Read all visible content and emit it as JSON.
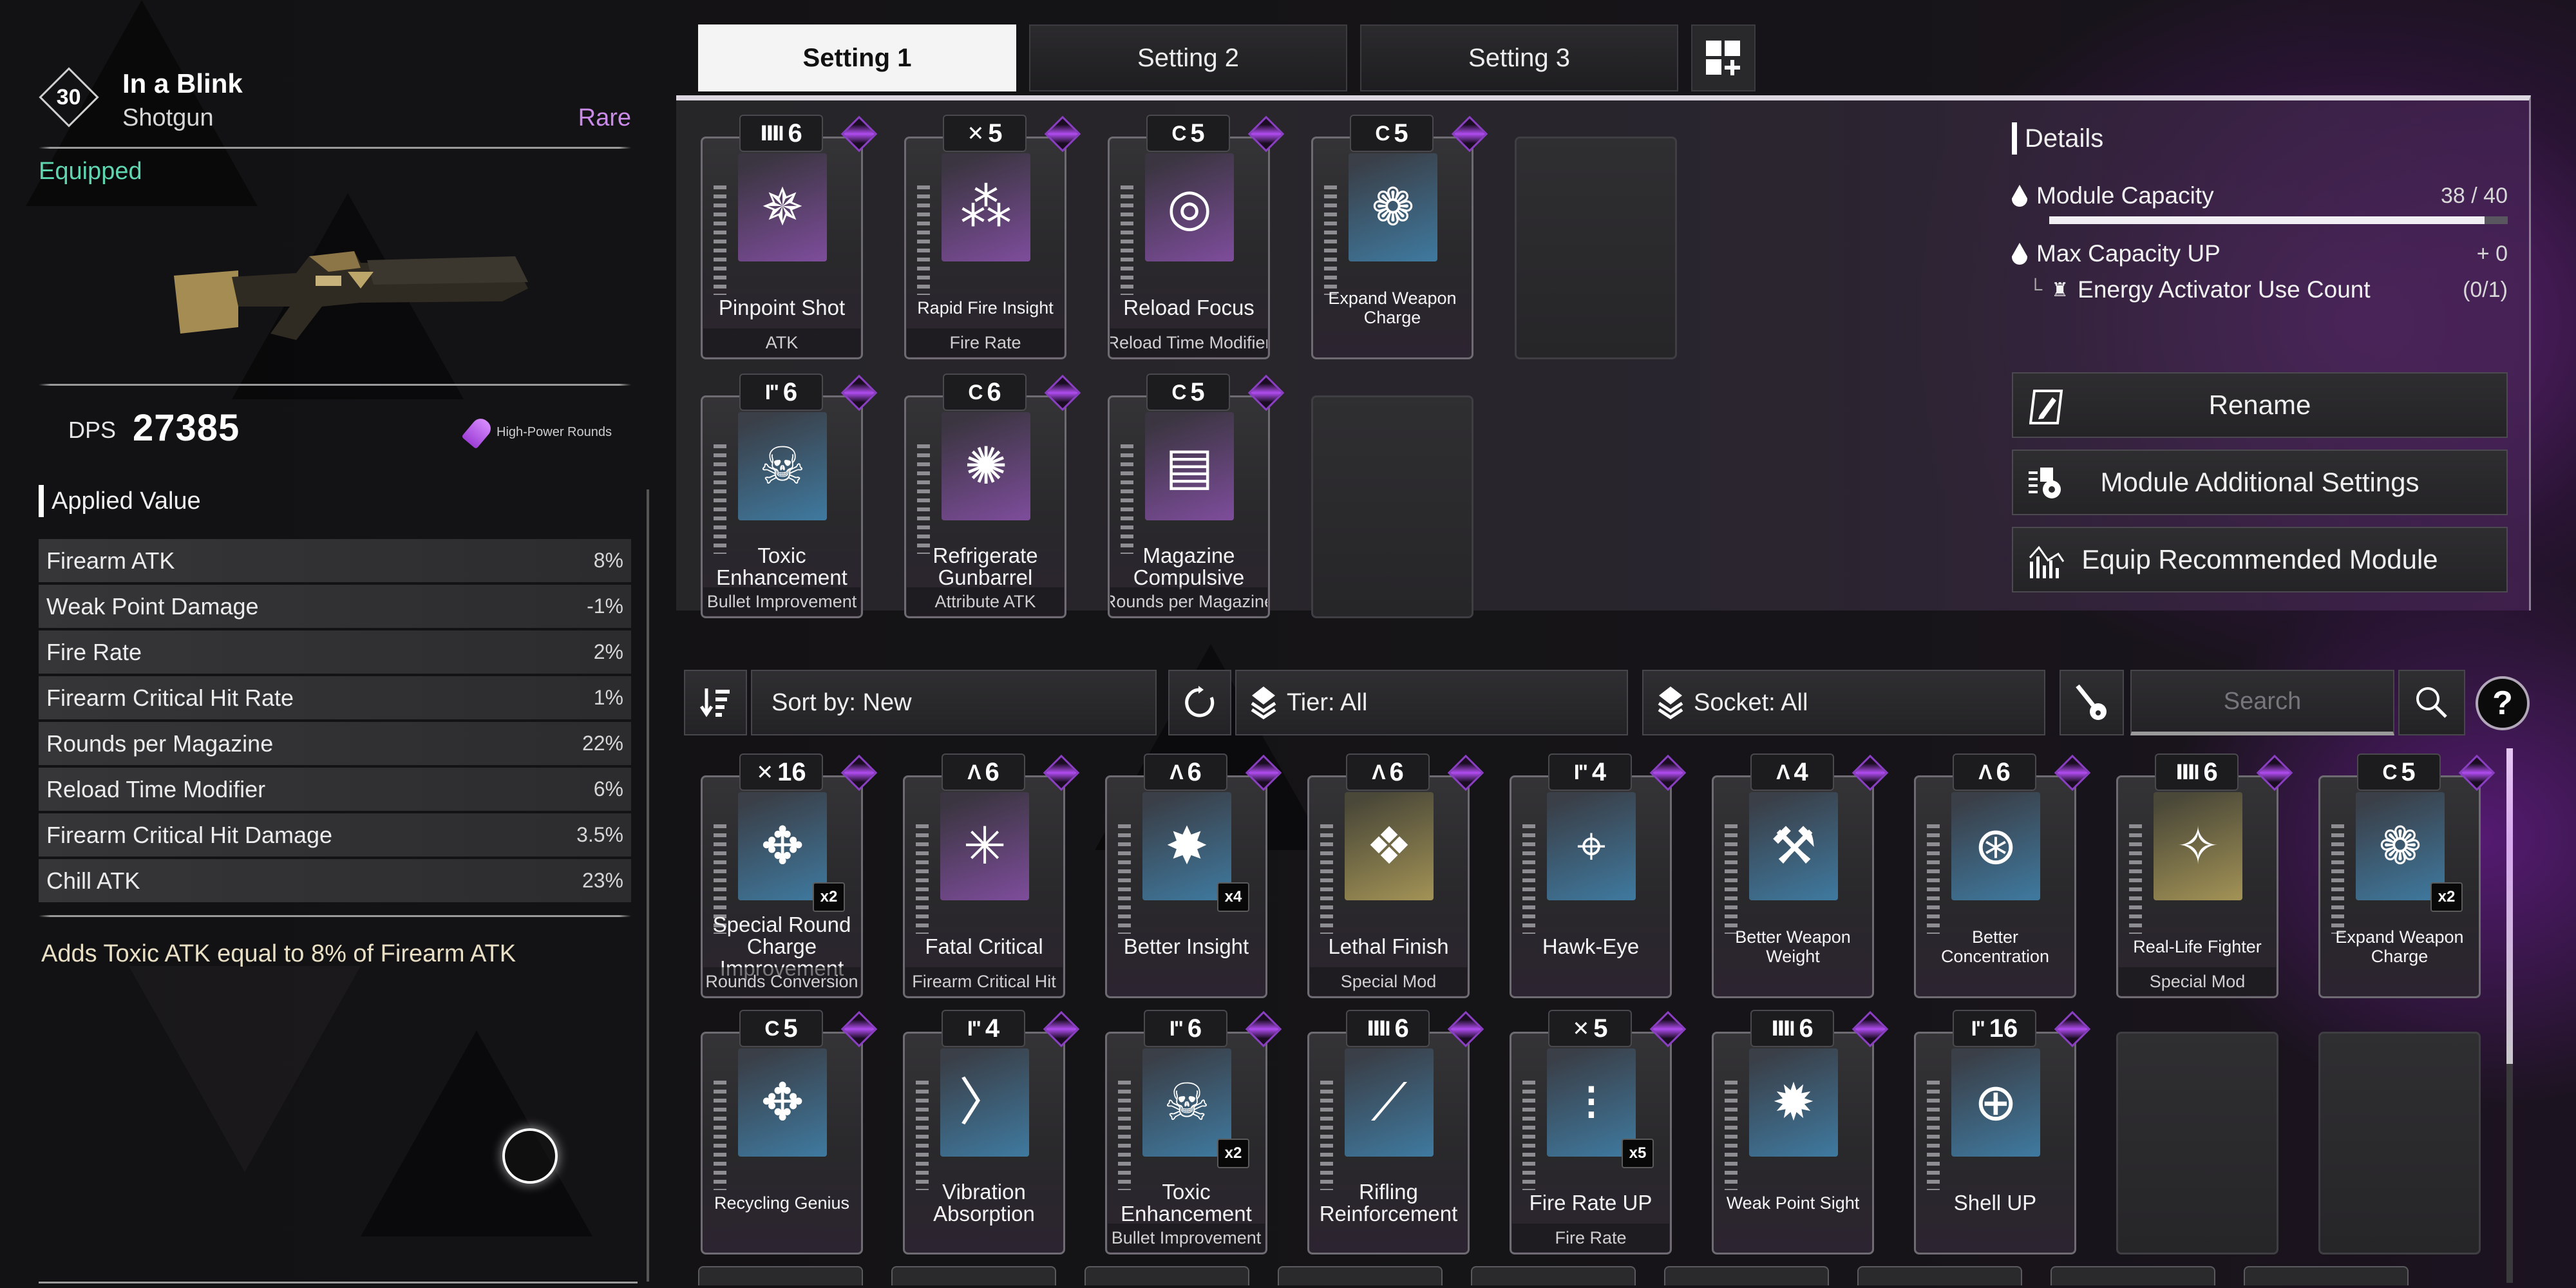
{
  "weapon": {
    "level": "30",
    "name": "In a Blink",
    "type": "Shotgun",
    "rarity": "Rare",
    "rarity_color": "#c98ae8",
    "status": "Equipped",
    "status_color": "#5fd6b0",
    "dps_label": "DPS",
    "dps_value": "27385",
    "ammo_type": "High-Power Rounds"
  },
  "applied_value": {
    "title": "Applied Value",
    "stats": [
      {
        "label": "Firearm ATK",
        "value": "8%"
      },
      {
        "label": "Weak Point Damage",
        "value": "-1%"
      },
      {
        "label": "Fire Rate",
        "value": "2%"
      },
      {
        "label": "Firearm Critical Hit Rate",
        "value": "1%"
      },
      {
        "label": "Rounds per Magazine",
        "value": "22%"
      },
      {
        "label": "Reload Time Modifier",
        "value": "6%"
      },
      {
        "label": "Firearm Critical Hit Damage",
        "value": "3.5%"
      },
      {
        "label": "Chill ATK",
        "value": "23%"
      }
    ],
    "effect": "Adds Toxic ATK equal to 8% of Firearm ATK"
  },
  "tabs": [
    {
      "label": "Setting 1",
      "active": true
    },
    {
      "label": "Setting 2",
      "active": false
    },
    {
      "label": "Setting 3",
      "active": false
    }
  ],
  "add_setting_icon": "grid-plus-icon",
  "equipped_modules": [
    {
      "tier": "6",
      "socket": "ⅢI",
      "socket_icon": "rutile-socket-icon",
      "name": "Pinpoint Shot",
      "category": "ATK",
      "color": "purple",
      "icon": "✵",
      "icon_name": "pinpoint-shot-icon"
    },
    {
      "tier": "5",
      "socket": "✕",
      "socket_icon": "xantic-socket-icon",
      "name": "Rapid Fire Insight",
      "category": "Fire Rate",
      "color": "purple",
      "icon": "⁂",
      "icon_name": "rapid-fire-icon",
      "small": true
    },
    {
      "tier": "5",
      "socket": "C",
      "socket_icon": "cerulean-socket-icon",
      "name": "Reload Focus",
      "category": "Reload Time Modifier",
      "color": "purple",
      "icon": "◎",
      "icon_name": "reload-focus-icon"
    },
    {
      "tier": "5",
      "socket": "C",
      "socket_icon": "cerulean-socket-icon",
      "name": "Expand Weapon Charge",
      "category": "",
      "color": "blue",
      "icon": "❁",
      "icon_name": "expand-weapon-charge-icon",
      "small": true
    },
    {
      "empty": true
    },
    {
      "tier": "6",
      "socket": "I\"",
      "socket_icon": "malachite-socket-icon",
      "name": "Toxic Enhancement",
      "category": "Bullet Improvement",
      "color": "blue",
      "icon": "☠",
      "icon_name": "toxic-enhancement-icon"
    },
    {
      "tier": "6",
      "socket": "C",
      "socket_icon": "cerulean-socket-icon",
      "name": "Refrigerate Gunbarrel",
      "category": "Attribute ATK",
      "color": "purple",
      "icon": "✺",
      "icon_name": "refrigerate-gunbarrel-icon"
    },
    {
      "tier": "5",
      "socket": "C",
      "socket_icon": "cerulean-socket-icon",
      "name": "Magazine Compulsive",
      "category": "Rounds per Magazine",
      "color": "purple",
      "icon": "▤",
      "icon_name": "magazine-compulsive-icon"
    },
    {
      "empty": true
    }
  ],
  "details": {
    "title": "Details",
    "module_capacity_label": "Module Capacity",
    "module_capacity_value": "38 / 40",
    "module_capacity_used": 38,
    "module_capacity_max": 40,
    "max_capacity_label": "Max Capacity UP",
    "max_capacity_value": "+ 0",
    "energy_activator_label": "Energy Activator Use Count",
    "energy_activator_value": "(0/1)"
  },
  "actions": [
    {
      "label": "Rename",
      "icon": "rename-icon"
    },
    {
      "label": "Module Additional Settings",
      "icon": "module-settings-icon"
    },
    {
      "label": "Equip Recommended Module",
      "icon": "recommend-chart-icon"
    }
  ],
  "filters": {
    "sort_label": "Sort by: New",
    "tier_label": "Tier: All",
    "socket_label": "Socket: All",
    "search_placeholder": "Search",
    "help_label": "?"
  },
  "inventory_modules": [
    {
      "tier": "16",
      "socket": "✕",
      "socket_icon": "xantic-socket-icon",
      "name": "Special Round Charge Improvement",
      "category": "Rounds Conversion",
      "color": "blue",
      "icon": "✥",
      "icon_name": "special-round-charge-icon",
      "count": "x2"
    },
    {
      "tier": "6",
      "socket": "Λ",
      "socket_icon": "almandine-socket-icon",
      "name": "Fatal Critical",
      "category": "Firearm Critical Hit",
      "color": "purple",
      "icon": "✳",
      "icon_name": "fatal-critical-icon"
    },
    {
      "tier": "6",
      "socket": "Λ",
      "socket_icon": "almandine-socket-icon",
      "name": "Better Insight",
      "category": "",
      "color": "blue",
      "icon": "✸",
      "icon_name": "better-insight-icon",
      "count": "x4"
    },
    {
      "tier": "6",
      "socket": "Λ",
      "socket_icon": "almandine-socket-icon",
      "name": "Lethal Finish",
      "category": "Special Mod",
      "color": "gold",
      "icon": "❖",
      "icon_name": "lethal-finish-icon"
    },
    {
      "tier": "4",
      "socket": "I\"",
      "socket_icon": "malachite-socket-icon",
      "name": "Hawk-Eye",
      "category": "",
      "color": "blue",
      "icon": "⌖",
      "icon_name": "hawk-eye-icon"
    },
    {
      "tier": "4",
      "socket": "Λ",
      "socket_icon": "almandine-socket-icon",
      "name": "Better Weapon Weight",
      "category": "",
      "color": "blue",
      "icon": "⚒",
      "icon_name": "better-weapon-weight-icon",
      "small": true
    },
    {
      "tier": "6",
      "socket": "Λ",
      "socket_icon": "almandine-socket-icon",
      "name": "Better Concentration",
      "category": "",
      "color": "blue",
      "icon": "⊛",
      "icon_name": "better-concentration-icon",
      "small": true
    },
    {
      "tier": "6",
      "socket": "ⅢI",
      "socket_icon": "rutile-socket-icon",
      "name": "Real-Life Fighter",
      "category": "Special Mod",
      "color": "gold",
      "icon": "✧",
      "icon_name": "real-life-fighter-icon",
      "small": true
    },
    {
      "tier": "5",
      "socket": "C",
      "socket_icon": "cerulean-socket-icon",
      "name": "Expand Weapon Charge",
      "category": "",
      "color": "blue",
      "icon": "❁",
      "icon_name": "expand-weapon-charge-icon",
      "count": "x2",
      "small": true
    },
    {
      "tier": "5",
      "socket": "C",
      "socket_icon": "cerulean-socket-icon",
      "name": "Recycling Genius",
      "category": "",
      "color": "blue",
      "icon": "✥",
      "icon_name": "recycling-genius-icon",
      "small": true
    },
    {
      "tier": "4",
      "socket": "I\"",
      "socket_icon": "malachite-socket-icon",
      "name": "Vibration Absorption",
      "category": "",
      "color": "blue",
      "icon": "〉",
      "icon_name": "vibration-absorption-icon"
    },
    {
      "tier": "6",
      "socket": "I\"",
      "socket_icon": "malachite-socket-icon",
      "name": "Toxic Enhancement",
      "category": "Bullet Improvement",
      "color": "blue",
      "icon": "☠",
      "icon_name": "toxic-enhancement-icon",
      "count": "x2"
    },
    {
      "tier": "6",
      "socket": "ⅢI",
      "socket_icon": "rutile-socket-icon",
      "name": "Rifling Reinforcement",
      "category": "",
      "color": "blue",
      "icon": "⟋",
      "icon_name": "rifling-reinforcement-icon"
    },
    {
      "tier": "5",
      "socket": "✕",
      "socket_icon": "xantic-socket-icon",
      "name": "Fire Rate UP",
      "category": "Fire Rate",
      "color": "blue",
      "icon": "⁝",
      "icon_name": "fire-rate-up-icon",
      "count": "x5"
    },
    {
      "tier": "6",
      "socket": "ⅢI",
      "socket_icon": "rutile-socket-icon",
      "name": "Weak Point Sight",
      "category": "",
      "color": "blue",
      "icon": "✹",
      "icon_name": "weak-point-sight-icon",
      "small": true
    },
    {
      "tier": "16",
      "socket": "I\"",
      "socket_icon": "malachite-socket-icon",
      "name": "Shell UP",
      "category": "",
      "color": "blue",
      "icon": "⊕",
      "icon_name": "shell-up-icon"
    },
    {
      "empty": true
    },
    {
      "empty": true
    }
  ]
}
